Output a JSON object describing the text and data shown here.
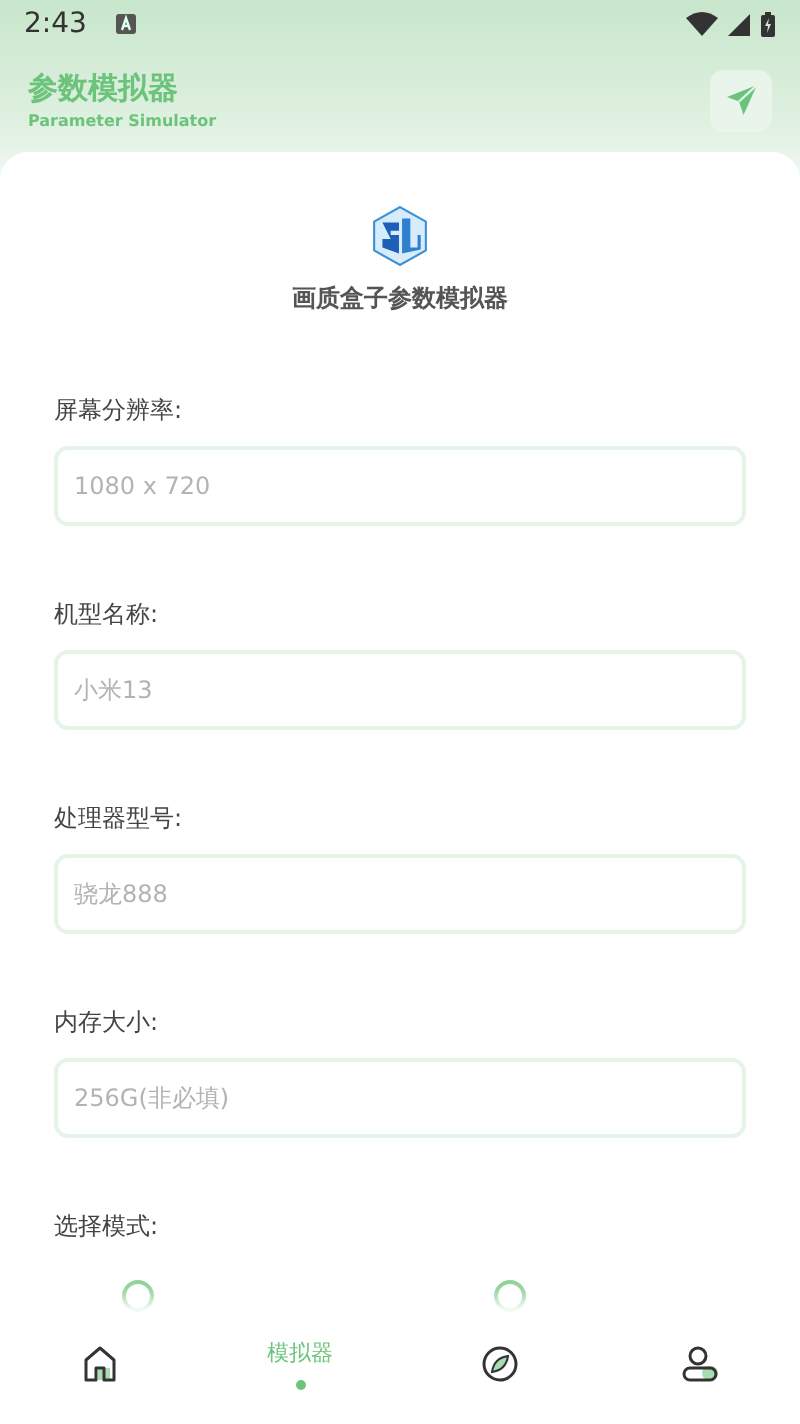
{
  "status_bar": {
    "time": "2:43"
  },
  "header": {
    "title": "参数模拟器",
    "subtitle": "Parameter Simulator"
  },
  "app_title": "画质盒子参数模拟器",
  "fields": [
    {
      "label": "屏幕分辨率:",
      "placeholder": "1080 x 720"
    },
    {
      "label": "机型名称:",
      "placeholder": "小米13"
    },
    {
      "label": "处理器型号:",
      "placeholder": "骁龙888"
    },
    {
      "label": "内存大小:",
      "placeholder": "256G(非必填)"
    }
  ],
  "mode": {
    "label": "选择模式:",
    "options": [
      {
        "selected": false
      },
      {
        "selected": false
      }
    ]
  },
  "nav": [
    {
      "kind": "home",
      "selected": false
    },
    {
      "kind": "text",
      "label": "模拟器",
      "selected": true
    },
    {
      "kind": "compass",
      "selected": false
    },
    {
      "kind": "user",
      "selected": false
    }
  ]
}
